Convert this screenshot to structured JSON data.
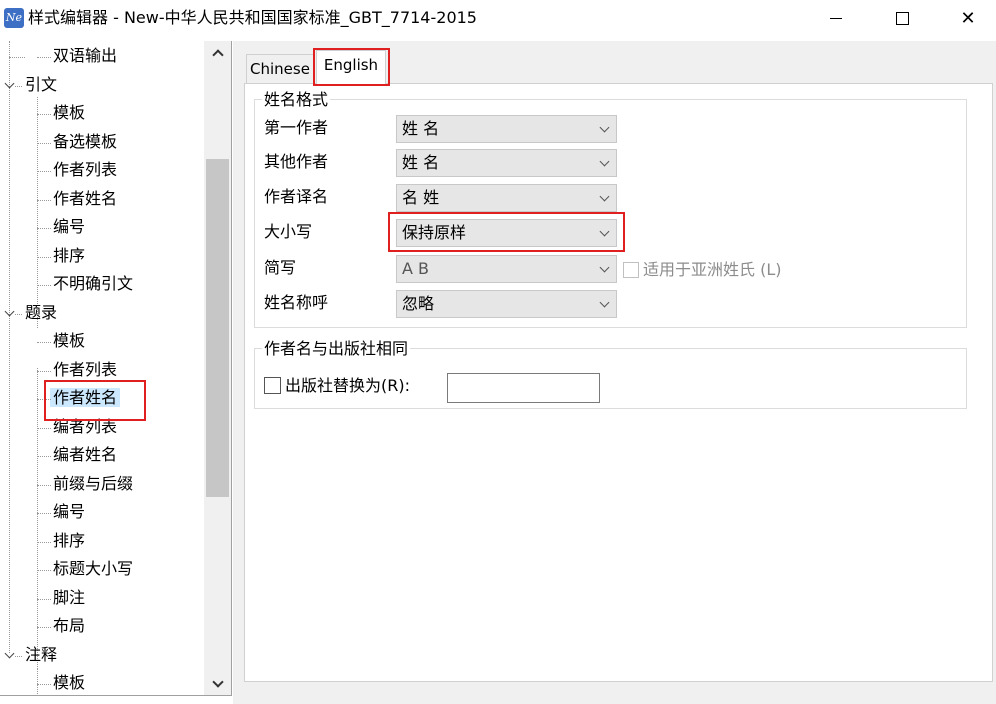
{
  "window": {
    "title": "样式编辑器 - New-中华人民共和国国家标准_GBT_7714-2015",
    "icon_text": "Ne",
    "close_glyph": "✕"
  },
  "tree": {
    "items": [
      {
        "label": "双语输出",
        "level": 1
      },
      {
        "label": "引文",
        "level": 0,
        "expanded": true
      },
      {
        "label": "模板",
        "level": 1
      },
      {
        "label": "备选模板",
        "level": 1
      },
      {
        "label": "作者列表",
        "level": 1
      },
      {
        "label": "作者姓名",
        "level": 1
      },
      {
        "label": "编号",
        "level": 1
      },
      {
        "label": "排序",
        "level": 1
      },
      {
        "label": "不明确引文",
        "level": 1
      },
      {
        "label": "题录",
        "level": 0,
        "expanded": true
      },
      {
        "label": "模板",
        "level": 1
      },
      {
        "label": "作者列表",
        "level": 1
      },
      {
        "label": "作者姓名",
        "level": 1,
        "selected": true
      },
      {
        "label": "编者列表",
        "level": 1
      },
      {
        "label": "编者姓名",
        "level": 1
      },
      {
        "label": "前缀与后缀",
        "level": 1
      },
      {
        "label": "编号",
        "level": 1
      },
      {
        "label": "排序",
        "level": 1
      },
      {
        "label": "标题大小写",
        "level": 1
      },
      {
        "label": "脚注",
        "level": 1
      },
      {
        "label": "布局",
        "level": 1
      },
      {
        "label": "注释",
        "level": 0,
        "expanded": true
      },
      {
        "label": "模板",
        "level": 1
      }
    ]
  },
  "tabs": [
    {
      "label": "Chinese",
      "active": false
    },
    {
      "label": "English",
      "active": true
    }
  ],
  "name_format": {
    "group_title": "姓名格式",
    "fields": [
      {
        "label": "第一作者",
        "value": "姓 名"
      },
      {
        "label": "其他作者",
        "value": "姓 名"
      },
      {
        "label": "作者译名",
        "value": "名 姓"
      },
      {
        "label": "大小写",
        "value": "保持原样"
      },
      {
        "label": "简写",
        "value": "A B",
        "disabled": true
      },
      {
        "label": "姓名称呼",
        "value": "忽略"
      }
    ],
    "asian_checkbox_label": "适用于亚洲姓氏 (L)"
  },
  "publisher": {
    "group_title": "作者名与出版社相同",
    "checkbox_label": "出版社替换为(R):",
    "replace_value": ""
  },
  "colors": {
    "highlight_box": "#e02020",
    "selection": "#cce8ff"
  }
}
